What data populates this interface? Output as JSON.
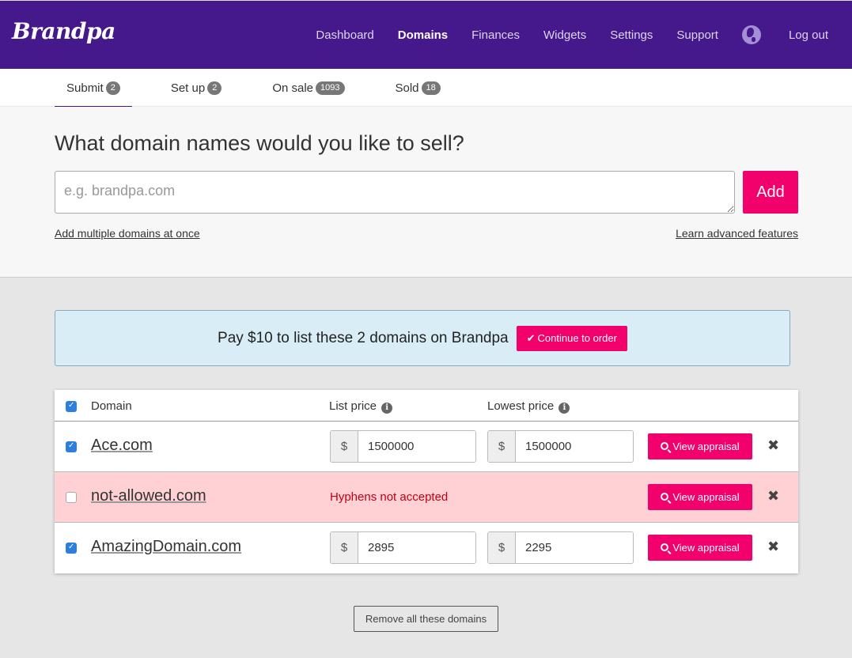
{
  "nav": {
    "logo": "Brandpa",
    "links": [
      {
        "label": "Dashboard",
        "active": false
      },
      {
        "label": "Domains",
        "active": true
      },
      {
        "label": "Finances",
        "active": false
      },
      {
        "label": "Widgets",
        "active": false
      },
      {
        "label": "Settings",
        "active": false
      },
      {
        "label": "Support",
        "active": false
      }
    ],
    "globe_icon": "globe-icon",
    "logout": "Log out"
  },
  "tabs": [
    {
      "label": "Submit",
      "count": "2",
      "active": true
    },
    {
      "label": "Set up",
      "count": "2",
      "active": false
    },
    {
      "label": "On sale",
      "count": "1093",
      "active": false
    },
    {
      "label": "Sold",
      "count": "18",
      "active": false
    }
  ],
  "submit": {
    "title": "What domain names would you like to sell?",
    "input_placeholder": "e.g. brandpa.com",
    "input_value": "",
    "add_label": "Add",
    "multi_link": "Add multiple domains at once",
    "advanced_link": "Learn advanced features"
  },
  "banner": {
    "text": "Pay $10 to list these 2 domains on Brandpa",
    "button": "Continue to order"
  },
  "table": {
    "headers": {
      "domain": "Domain",
      "list_price": "List price",
      "lowest_price": "Lowest price"
    },
    "header_checked": true,
    "currency": "$",
    "appraisal_label": "View appraisal",
    "rows": [
      {
        "domain": "Ace.com",
        "checked": true,
        "error": "",
        "list_price": "1500000",
        "lowest_price": "1500000"
      },
      {
        "domain": "not-allowed.com",
        "checked": false,
        "error": "Hyphens not accepted",
        "list_price": "",
        "lowest_price": ""
      },
      {
        "domain": "AmazingDomain.com",
        "checked": true,
        "error": "",
        "list_price": "2895",
        "lowest_price": "2295"
      }
    ]
  },
  "remove_all": "Remove all these domains",
  "colors": {
    "brand_purple": "#45188c",
    "accent_pink": "#f2006b",
    "error_bg": "#ffd1d4",
    "info_bg": "#d9edf7"
  }
}
